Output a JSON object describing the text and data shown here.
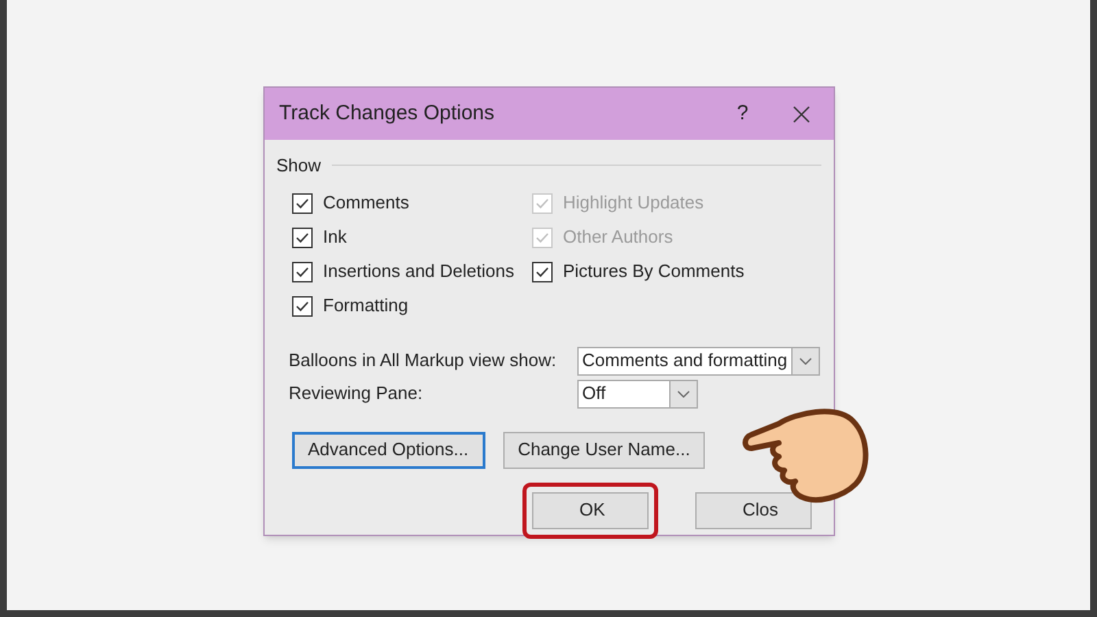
{
  "dialog": {
    "title": "Track Changes Options",
    "help": "?",
    "section": "Show",
    "checkboxes_left": [
      {
        "label": "Comments",
        "checked": true,
        "disabled": false
      },
      {
        "label": "Ink",
        "checked": true,
        "disabled": false
      },
      {
        "label": "Insertions and Deletions",
        "checked": true,
        "disabled": false
      },
      {
        "label": "Formatting",
        "checked": true,
        "disabled": false
      }
    ],
    "checkboxes_right": [
      {
        "label": "Highlight Updates",
        "checked": true,
        "disabled": true
      },
      {
        "label": "Other Authors",
        "checked": true,
        "disabled": true
      },
      {
        "label": "Pictures By Comments",
        "checked": true,
        "disabled": false
      }
    ],
    "balloons": {
      "label": "Balloons in All Markup view show:",
      "value": "Comments and formatting"
    },
    "reviewing_pane": {
      "label": "Reviewing Pane:",
      "value": "Off"
    },
    "buttons": [
      {
        "label": "Advanced Options...",
        "focused": true
      },
      {
        "label": "Change User Name...",
        "focused": false
      }
    ],
    "footer_buttons": [
      {
        "label": "OK",
        "highlighted": true
      },
      {
        "label": "Clos",
        "highlighted": false
      }
    ]
  }
}
